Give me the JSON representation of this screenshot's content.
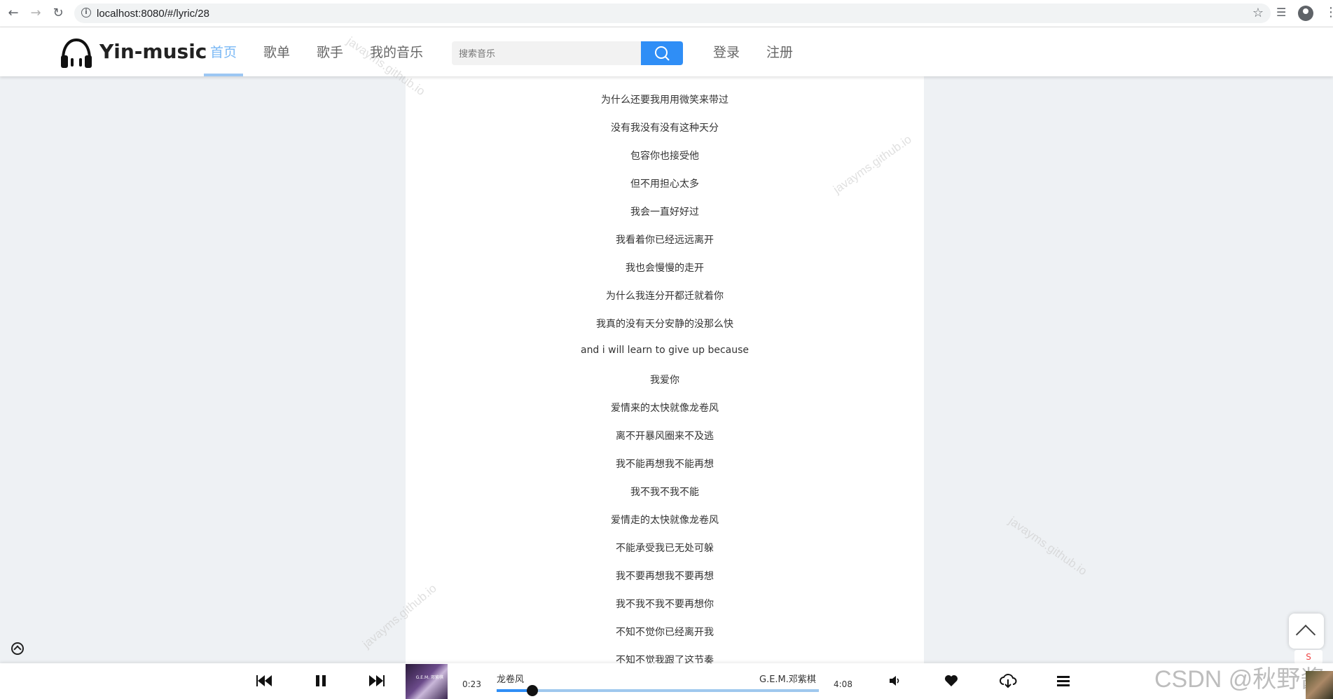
{
  "browser": {
    "url": "localhost:8080/#/lyric/28"
  },
  "header": {
    "logo_text": "Yin-music",
    "nav": [
      "首页",
      "歌单",
      "歌手",
      "我的音乐"
    ],
    "search_placeholder": "搜索音乐",
    "login": "登录",
    "register": "注册",
    "accent_color": "#7ab8f5",
    "search_button_color": "#2f8ef6"
  },
  "lyrics": [
    "为什么还要我用用微笑来带过",
    "没有我没有没有这种天分",
    "包容你也接受他",
    "但不用担心太多",
    "我会一直好好过",
    "我看着你已经远远离开",
    "我也会慢慢的走开",
    "为什么我连分开都迁就着你",
    "我真的没有天分安静的没那么快",
    "and i will learn to give up because",
    "我爱你",
    "爱情来的太快就像龙卷风",
    "离不开暴风圈来不及逃",
    "我不能再想我不能再想",
    "我不我不我不能",
    "爱情走的太快就像龙卷风",
    "不能承受我已无处可躲",
    "我不要再想我不要再想",
    "我不我不我不要再想你",
    "不知不觉你已经离开我",
    "不知不觉我跟了这节奏"
  ],
  "watermark": "javayms.github.io",
  "player": {
    "song_title": "龙卷风",
    "artist": "G.E.M.邓紫棋",
    "current_time": "0:23",
    "total_time": "4:08",
    "progress": 0.11,
    "cover_text": "G.E.M.\n邓紫棋"
  },
  "overlay": {
    "csdn_text": "CSDN @秋野酱",
    "side_badge": "S"
  }
}
